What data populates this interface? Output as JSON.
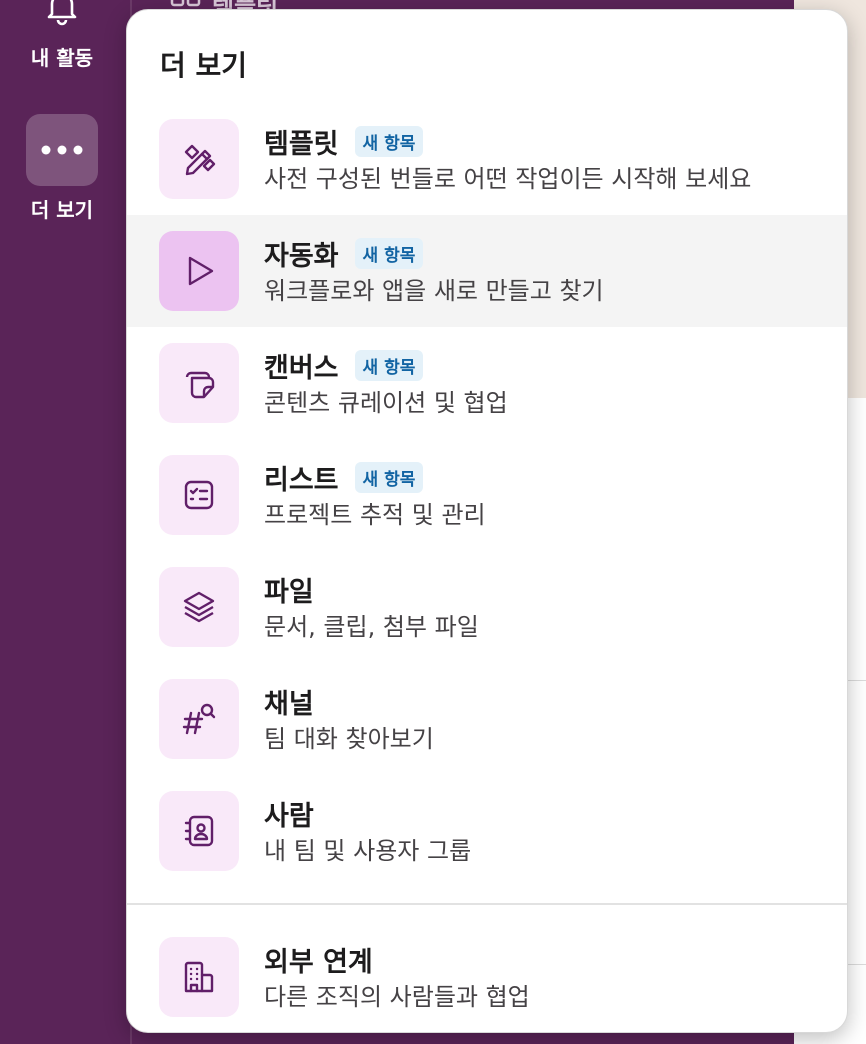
{
  "rail": {
    "activity_label": "내 활동",
    "more_label": "더 보기"
  },
  "peek": {
    "text": "템플릿"
  },
  "popup": {
    "title": "더 보기",
    "items": [
      {
        "title": "템플릿",
        "badge": "새 항목",
        "subtitle": "사전 구성된 번들로 어떤 작업이든 시작해 보세요",
        "icon": "template-icon"
      },
      {
        "title": "자동화",
        "badge": "새 항목",
        "subtitle": "워크플로와 앱을 새로 만들고 찾기",
        "icon": "play-icon"
      },
      {
        "title": "캔버스",
        "badge": "새 항목",
        "subtitle": "콘텐츠 큐레이션 및 협업",
        "icon": "canvas-icon"
      },
      {
        "title": "리스트",
        "badge": "새 항목",
        "subtitle": "프로젝트 추적 및 관리",
        "icon": "list-icon"
      },
      {
        "title": "파일",
        "subtitle": "문서, 클립, 첨부 파일",
        "icon": "layers-icon"
      },
      {
        "title": "채널",
        "subtitle": "팀 대화 찾아보기",
        "icon": "channel-search-icon"
      },
      {
        "title": "사람",
        "subtitle": "내 팀 및 사용자 그룹",
        "icon": "people-directory-icon"
      }
    ],
    "external": {
      "title": "외부 연계",
      "subtitle": "다른 조직의 사람들과 협업",
      "icon": "building-icon"
    }
  },
  "colors": {
    "sidebar": "#5a2458",
    "icon_bg": "#f9e9f9",
    "icon_bg_hover": "#ecc3f1",
    "icon_stroke": "#611f69",
    "badge_bg": "#e4f1f9",
    "badge_text": "#1264a3"
  }
}
